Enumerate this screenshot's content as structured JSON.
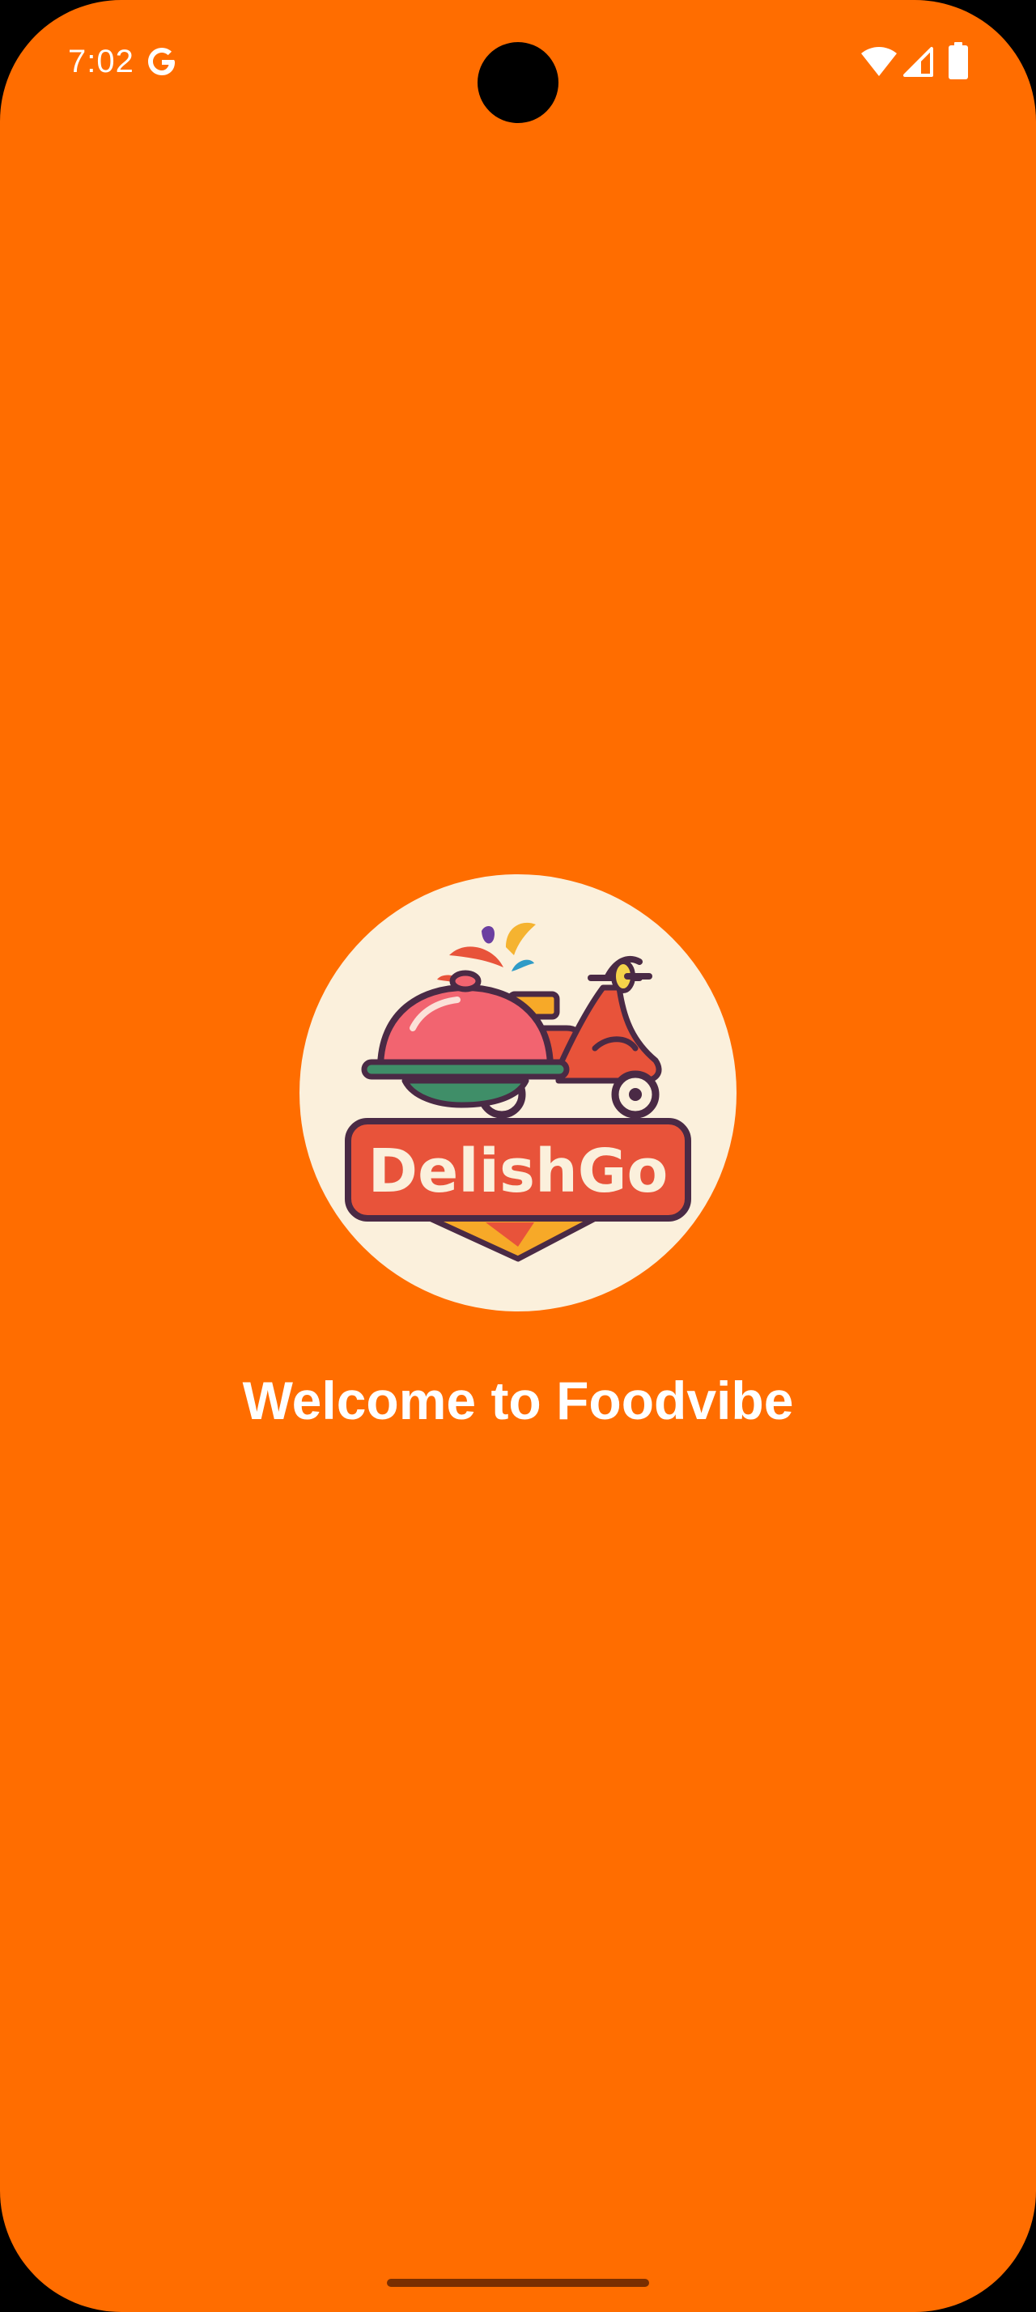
{
  "status_bar": {
    "time": "7:02",
    "google_icon": "google-g-icon",
    "wifi_icon": "wifi-icon",
    "signal_icon": "cell-signal-icon",
    "battery_icon": "battery-icon"
  },
  "splash": {
    "logo_text": "DelishGo",
    "logo_icon": "delivery-scooter-cloche-logo",
    "welcome": "Welcome to Foodvibe"
  },
  "colors": {
    "background": "#FF6D00",
    "logo_circle": "#FBF0DC",
    "text": "#FFFFFF",
    "badge": "#E85A2C",
    "outline": "#4A2A45"
  }
}
